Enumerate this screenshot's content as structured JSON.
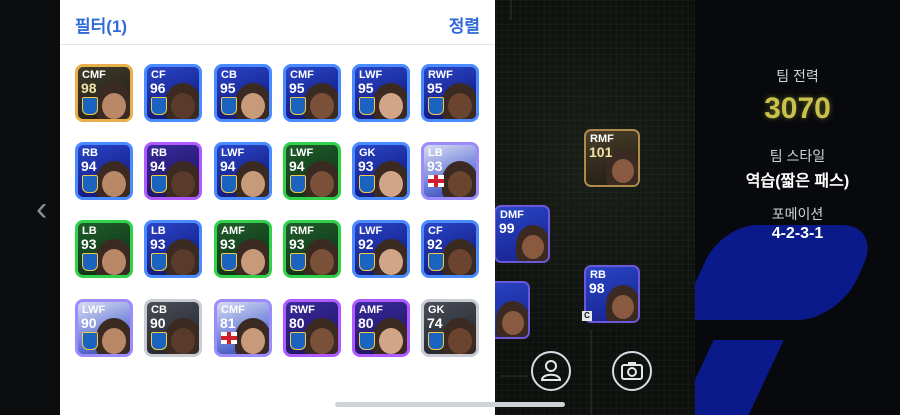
{
  "header": {
    "filter_label": "필터(1)",
    "sort_label": "정렬"
  },
  "nav": {
    "prev_icon": "chevron-left-icon",
    "prev_glyph": "‹"
  },
  "team": {
    "strength_label": "팀 전력",
    "strength_value": "3070",
    "style_label": "팀 스타일",
    "style_value": "역습(짧은 패스)",
    "formation_label": "포메이션",
    "formation_value": "4-2-3-1"
  },
  "cards": [
    {
      "pos": "CMF",
      "ovr": "98",
      "tier": "gold"
    },
    {
      "pos": "CF",
      "ovr": "96",
      "tier": "blue"
    },
    {
      "pos": "CB",
      "ovr": "95",
      "tier": "blue"
    },
    {
      "pos": "CMF",
      "ovr": "95",
      "tier": "blue"
    },
    {
      "pos": "LWF",
      "ovr": "95",
      "tier": "blue"
    },
    {
      "pos": "RWF",
      "ovr": "95",
      "tier": "blue"
    },
    {
      "pos": "RB",
      "ovr": "94",
      "tier": "blue"
    },
    {
      "pos": "RB",
      "ovr": "94",
      "tier": "purple"
    },
    {
      "pos": "LWF",
      "ovr": "94",
      "tier": "blue"
    },
    {
      "pos": "LWF",
      "ovr": "94",
      "tier": "green"
    },
    {
      "pos": "GK",
      "ovr": "93",
      "tier": "blue"
    },
    {
      "pos": "LB",
      "ovr": "93",
      "tier": "light",
      "flag": "england"
    },
    {
      "pos": "LB",
      "ovr": "93",
      "tier": "green"
    },
    {
      "pos": "LB",
      "ovr": "93",
      "tier": "blue"
    },
    {
      "pos": "AMF",
      "ovr": "93",
      "tier": "green"
    },
    {
      "pos": "RMF",
      "ovr": "93",
      "tier": "green"
    },
    {
      "pos": "LWF",
      "ovr": "92",
      "tier": "blue"
    },
    {
      "pos": "CF",
      "ovr": "92",
      "tier": "blue"
    },
    {
      "pos": "LWF",
      "ovr": "90",
      "tier": "light"
    },
    {
      "pos": "CB",
      "ovr": "90",
      "tier": "silver"
    },
    {
      "pos": "CMF",
      "ovr": "81",
      "tier": "light",
      "flag": "england"
    },
    {
      "pos": "RWF",
      "ovr": "80",
      "tier": "purple"
    },
    {
      "pos": "AMF",
      "ovr": "80",
      "tier": "purple"
    },
    {
      "pos": "GK",
      "ovr": "74",
      "tier": "silver"
    }
  ],
  "field_players": [
    {
      "pos": "RMF",
      "ovr": "101",
      "tier": "gold"
    },
    {
      "pos": "DMF",
      "ovr": "99",
      "tier": "blue"
    },
    {
      "pos": "",
      "ovr": "",
      "tier": "blue"
    },
    {
      "pos": "RB",
      "ovr": "98",
      "tier": "blue"
    }
  ],
  "captain_marker": "C",
  "buttons": {
    "profile_icon": "person-icon",
    "camera_icon": "camera-icon"
  }
}
